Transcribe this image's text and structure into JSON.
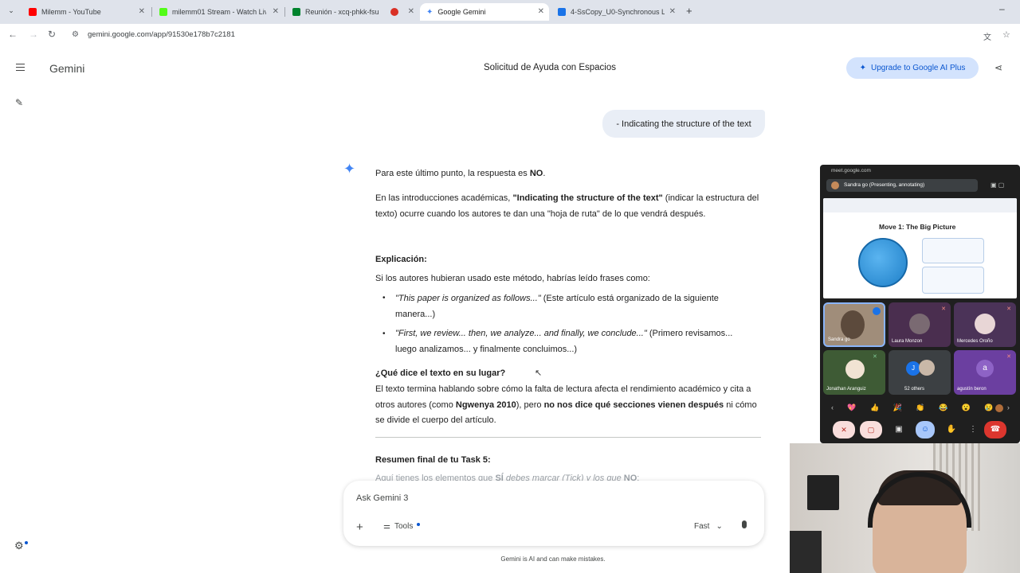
{
  "browser": {
    "tabs": [
      {
        "title": "Milemm - YouTube",
        "color": "#ff0000"
      },
      {
        "title": "milemm01 Stream - Watch Live",
        "color": "#53fc18"
      },
      {
        "title": "Reunión - xcq-phkk-fsu",
        "color": "#00832d"
      },
      {
        "title": "",
        "color": "#d93025"
      },
      {
        "title": "Google Gemini",
        "color": "#4285f4"
      },
      {
        "title": "4-SsCopy_U0-Synchronous Les",
        "color": "#1a73e8"
      }
    ],
    "url": "gemini.google.com/app/91530e178b7c2181"
  },
  "app": {
    "name": "Gemini",
    "conversation_title": "Solicitud de Ayuda con Espacios",
    "upgrade_label": "Upgrade to Google AI Plus"
  },
  "chat": {
    "user_message": "- Indicating the structure of the text",
    "response": {
      "p1_a": "Para este último punto, la respuesta es ",
      "p1_b": "NO",
      "p1_c": ".",
      "p2_a": "En las introducciones académicas, ",
      "p2_b": "\"Indicating the structure of the text\"",
      "p2_c": " (indicar la estructura del texto) ocurre cuando los autores te dan una \"hoja de ruta\" de lo que vendrá después.",
      "h_explicacion": "Explicación:",
      "p3": "Si los autores hubieran usado este método, habrías leído frases como:",
      "b1_i": "\"This paper is organized as follows...\"",
      "b1_t": " (Este artículo está organizado de la siguiente manera...)",
      "b2_i": "\"First, we review... then, we analyze... and finally, we conclude...\"",
      "b2_t": " (Primero revisamos... luego analizamos... y finalmente concluimos...)",
      "h_que_dice": "¿Qué dice el texto en su lugar?",
      "p4_a": "El texto termina hablando sobre cómo la falta de lectura afecta el rendimiento académico y cita a otros autores (como ",
      "p4_b": "Ngwenya 2010",
      "p4_c": "), pero ",
      "p4_d": "no nos dice qué secciones vienen después",
      "p4_e": " ni cómo se divide el cuerpo del artículo.",
      "h_resumen": "Resumen final de tu Task 5:",
      "p5_a": "Aquí tienes los elementos que ",
      "p5_b": "SÍ",
      "p5_c": " debes marcar (Tick) y los que ",
      "p5_d": "NO",
      "p5_e": ":"
    }
  },
  "composer": {
    "placeholder": "Ask Gemini 3",
    "tools_label": "Tools",
    "mode_label": "Fast",
    "disclaimer": "Gemini is AI and can make mistakes."
  },
  "meet": {
    "url": "meet.google.com",
    "presenter": "Sandra go (Presenting, annotating)",
    "slide_title": "Move 1: The Big Picture",
    "participants": [
      {
        "name": "Sandra go",
        "bg": "#a08d7a"
      },
      {
        "name": "Laura Monzon",
        "bg": "#4a2e4f"
      },
      {
        "name": "Mercedes Oroño",
        "bg": "#4b3358"
      },
      {
        "name": "Jonathan Aranguiz",
        "bg": "#3e5b35"
      },
      {
        "name": "52 others",
        "bg": "#3c4043"
      },
      {
        "name": "agustín beron",
        "bg": "#6b3fa0"
      }
    ],
    "reactions": [
      "💖",
      "👍",
      "🎉",
      "👏",
      "😂",
      "😮",
      "😢"
    ]
  }
}
